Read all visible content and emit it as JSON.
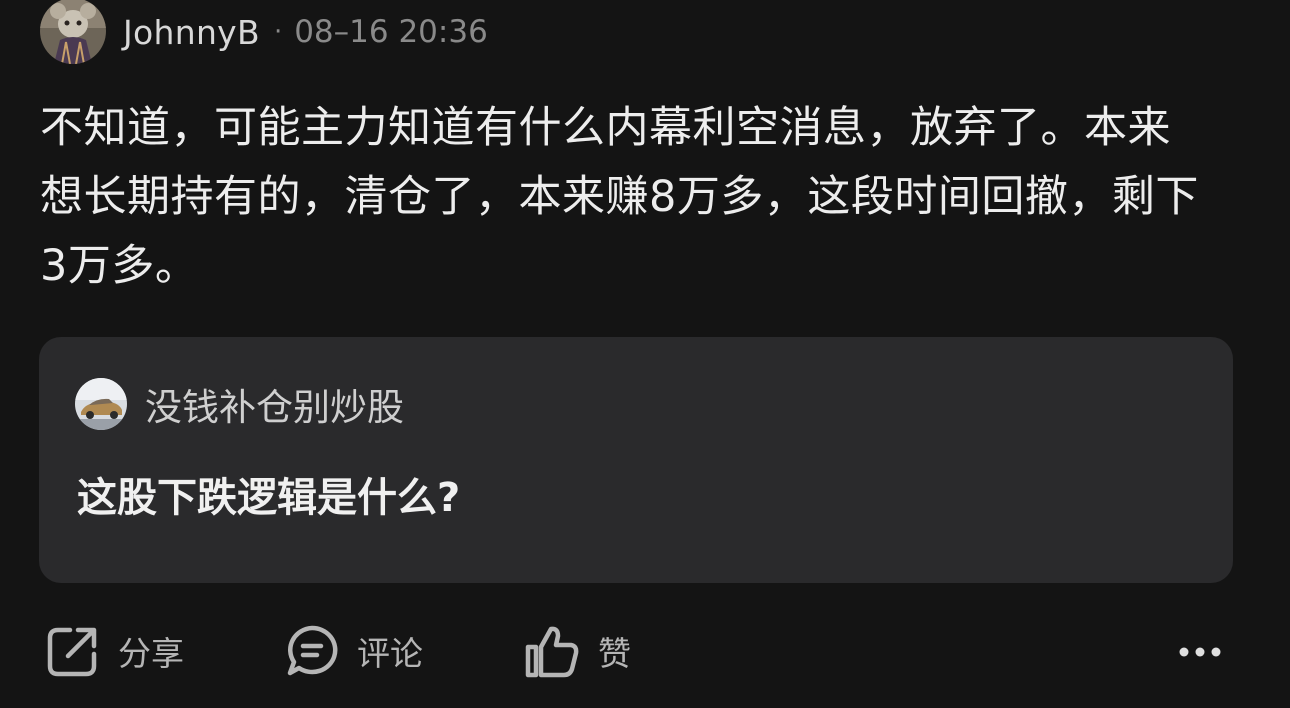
{
  "post": {
    "author": "JohnnyB",
    "separator": "·",
    "time": "08–16 20:36",
    "body": "不知道，可能主力知道有什么内幕利空消息，放弃了。本来想长期持有的，清仓了，本来赚8万多，这段时间回撤，剩下3万多。"
  },
  "quote": {
    "author": "没钱补仓别炒股",
    "text": "这股下跌逻辑是什么?"
  },
  "actions": {
    "share": "分享",
    "comment": "评论",
    "like": "赞"
  },
  "icons": {
    "share": "share-icon",
    "comment": "comment-icon",
    "like": "thumbs-up-icon",
    "more": "more-icon"
  }
}
